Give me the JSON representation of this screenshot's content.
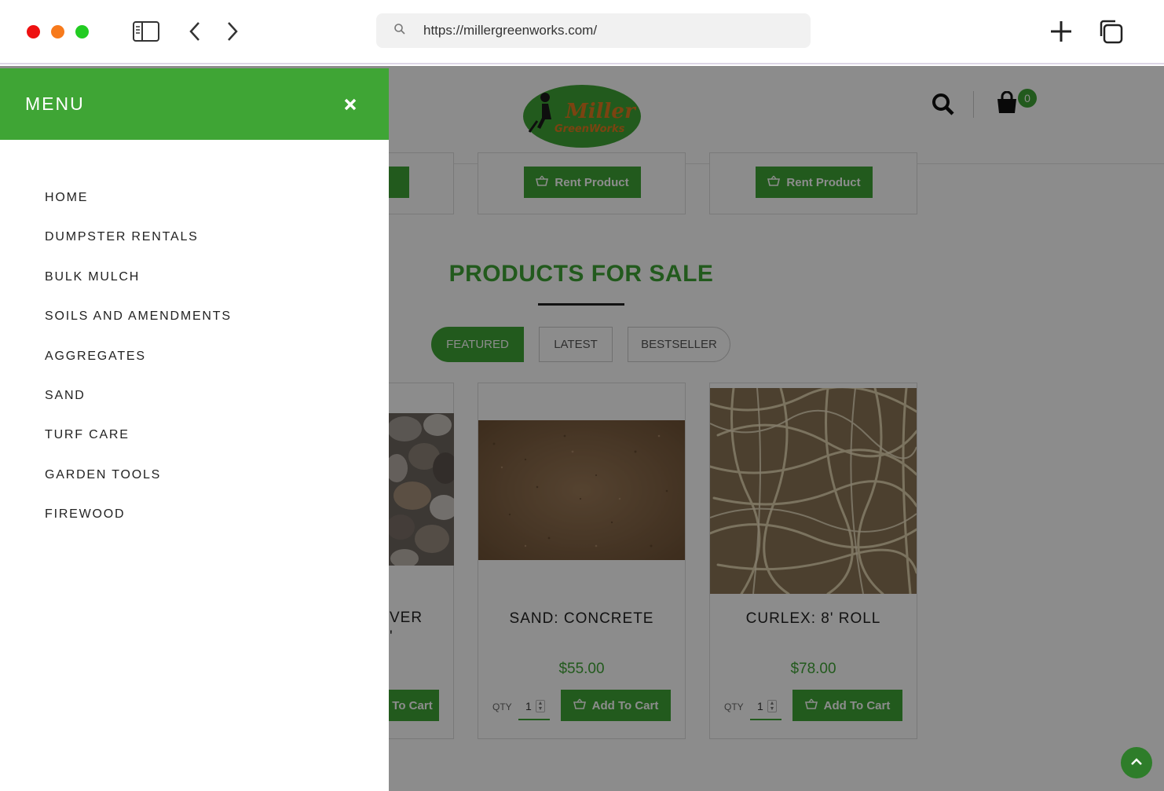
{
  "browser": {
    "url": "https://millergreenworks.com/",
    "icons": [
      "sidebar-icon",
      "back-icon",
      "forward-icon",
      "search-icon",
      "new-tab-icon",
      "tabs-icon"
    ]
  },
  "header": {
    "logo_text_1": "Miller",
    "logo_text_2": "GreenWorks",
    "cart_count": "0"
  },
  "rentals": {
    "buttons": [
      "t",
      "Rent Product",
      "Rent Product"
    ]
  },
  "sale": {
    "title": "PRODUCTS FOR SALE",
    "tabs": [
      "FEATURED",
      "LATEST",
      "BESTSELLER"
    ],
    "products": [
      {
        "name_partial_1": "VER",
        "name_partial_2": "'",
        "cart_partial": "To Cart"
      },
      {
        "name": "SAND: CONCRETE",
        "price": "$55.00",
        "qty_label": "QTY",
        "qty": "1",
        "cart": "Add To Cart"
      },
      {
        "name": "CURLEX: 8' ROLL",
        "price": "$78.00",
        "qty_label": "QTY",
        "qty": "1",
        "cart": "Add To Cart"
      }
    ]
  },
  "menu": {
    "title": "MENU",
    "items": [
      "HOME",
      "DUMPSTER RENTALS",
      "BULK MULCH",
      "SOILS AND AMENDMENTS",
      "AGGREGATES",
      "SAND",
      "TURF CARE",
      "GARDEN TOOLS",
      "FIREWOOD"
    ]
  },
  "colors": {
    "brand_green": "#3fa535",
    "dark_green": "#2e7d2a"
  }
}
